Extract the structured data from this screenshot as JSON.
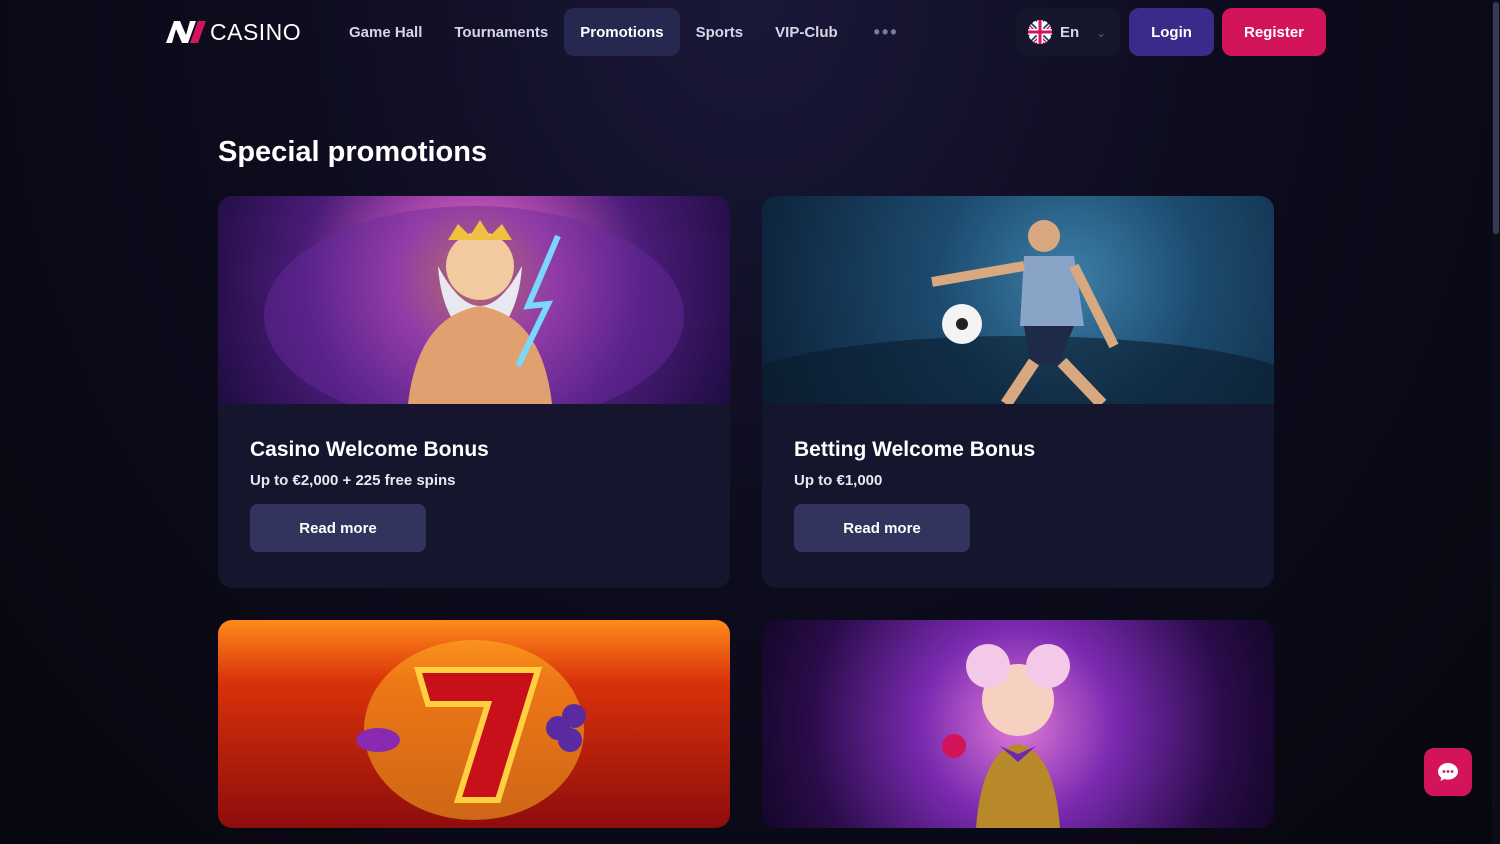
{
  "brand": {
    "name": "CASINO",
    "logo_glyph": "N"
  },
  "nav": {
    "items": [
      {
        "label": "Game Hall",
        "active": false
      },
      {
        "label": "Tournaments",
        "active": false
      },
      {
        "label": "Promotions",
        "active": true
      },
      {
        "label": "Sports",
        "active": false
      },
      {
        "label": "VIP-Club",
        "active": false
      }
    ],
    "more_label": "•••"
  },
  "language": {
    "label": "En",
    "flag": "uk-flag-icon"
  },
  "auth": {
    "login_label": "Login",
    "register_label": "Register"
  },
  "page": {
    "title": "Special promotions"
  },
  "promotions": [
    {
      "title": "Casino Welcome Bonus",
      "subtitle": "Up to €2,000 + 225 free spins",
      "button": "Read more",
      "image": "zeus-illustration"
    },
    {
      "title": "Betting Welcome Bonus",
      "subtitle": "Up to €1,000",
      "button": "Read more",
      "image": "soccer-player-illustration"
    },
    {
      "title": "",
      "subtitle": "",
      "button": "",
      "image": "lucky-seven-illustration"
    },
    {
      "title": "",
      "subtitle": "",
      "button": "",
      "image": "vip-clown-illustration"
    }
  ],
  "colors": {
    "accent": "#d4145a",
    "login": "#3a2a8a",
    "active_tab": "#272850",
    "card_bg": "#15152e"
  },
  "chat": {
    "icon": "chat-bubble-icon"
  }
}
